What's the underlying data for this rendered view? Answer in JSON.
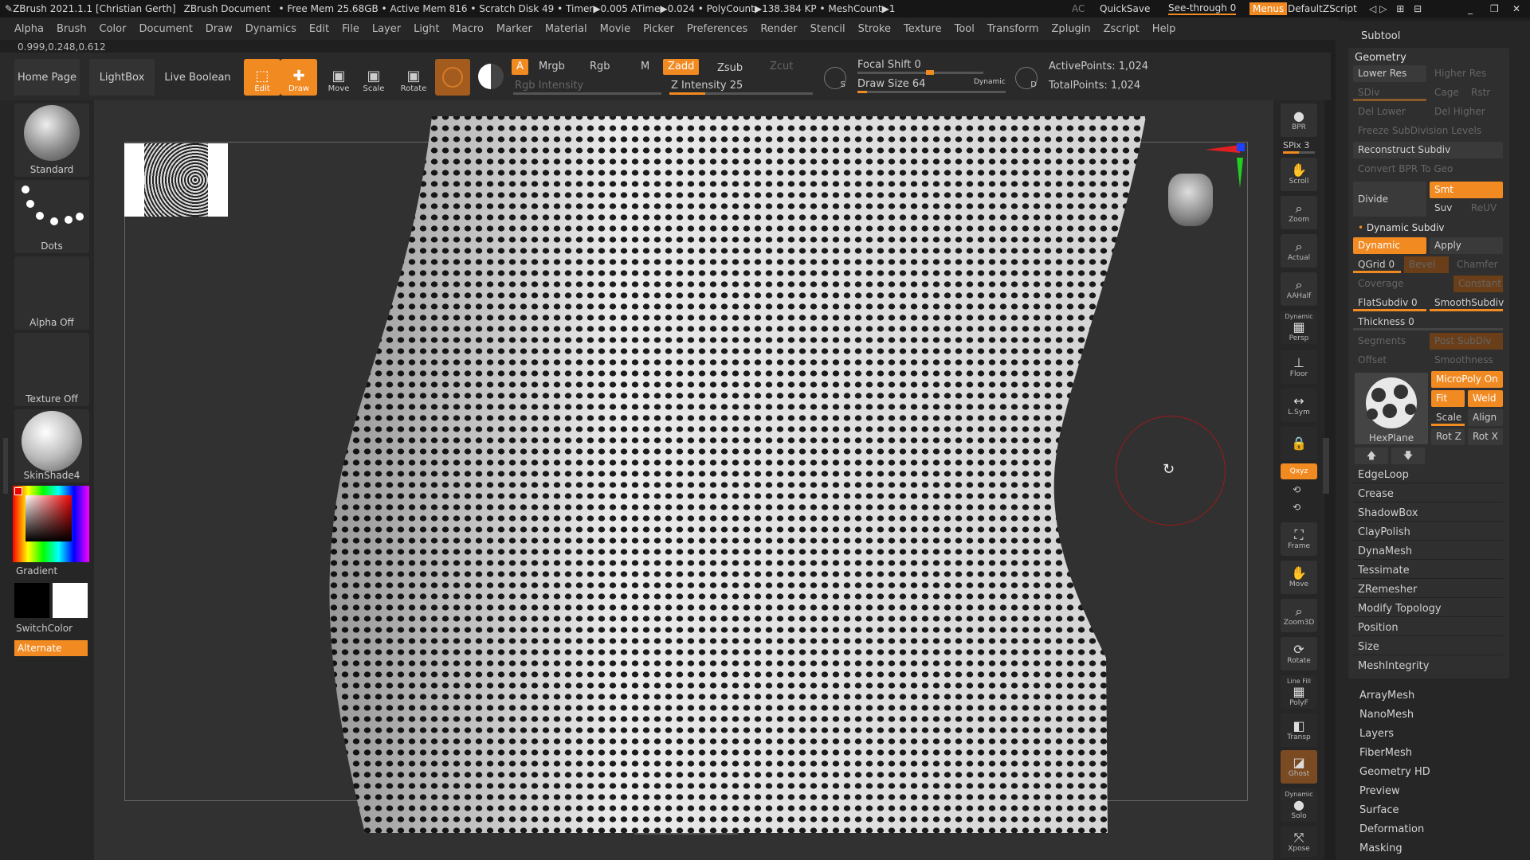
{
  "titlebar": {
    "app": "ZBrush 2021.1.1 [Christian Gerth]",
    "doc": "ZBrush Document",
    "stats": "• Free Mem 25.68GB • Active Mem 816 • Scratch Disk 49 • Timer▶0.005 ATime▶0.024 • PolyCount▶138.384 KP • MeshCount▶1",
    "ac": "AC",
    "quicksave": "QuickSave",
    "seethrough": "See-through 0",
    "menus": "Menus",
    "script": "DefaultZScript"
  },
  "menubar": [
    "Alpha",
    "Brush",
    "Color",
    "Document",
    "Draw",
    "Dynamics",
    "Edit",
    "File",
    "Layer",
    "Light",
    "Macro",
    "Marker",
    "Material",
    "Movie",
    "Picker",
    "Preferences",
    "Render",
    "Stencil",
    "Stroke",
    "Texture",
    "Tool",
    "Transform",
    "Zplugin",
    "Zscript",
    "Help"
  ],
  "coords": "0.999,0.248,0.612",
  "shelf": {
    "home": "Home Page",
    "lightbox": "LightBox",
    "liveboolean": "Live Boolean",
    "edit": "Edit",
    "draw": "Draw",
    "move": "Move",
    "scale": "Scale",
    "rotate": "Rotate",
    "a": "A",
    "mrgb": "Mrgb",
    "rgb": "Rgb",
    "m": "M",
    "rgbintensity": "Rgb Intensity",
    "zadd": "Zadd",
    "zsub": "Zsub",
    "zcut": "Zcut",
    "zintensity": "Z Intensity 25",
    "zintensity_value": 25,
    "focalshift": "Focal Shift 0",
    "drawsize": "Draw Size 64",
    "drawsize_value": 64,
    "dynamic": "Dynamic",
    "s": "S",
    "d": "D",
    "activepoints": "ActivePoints: 1,024",
    "totalpoints": "TotalPoints: 1,024"
  },
  "leftshelf": {
    "standard": "Standard",
    "dots": "Dots",
    "alphaoff": "Alpha Off",
    "textureoff": "Texture Off",
    "skinshade": "SkinShade4",
    "gradient": "Gradient",
    "switchcolor": "SwitchColor",
    "alternate": "Alternate"
  },
  "rightshelf": {
    "bpr": "BPR",
    "spix": "SPix 3",
    "scroll": "Scroll",
    "zoom": "Zoom",
    "actual": "Actual",
    "aahalf": "AAHalf",
    "dynamic": "Dynamic",
    "persp": "Persp",
    "floor": "Floor",
    "lsym": "L.Sym",
    "xyz": "Qxyz",
    "frame": "Frame",
    "move": "Move",
    "zoom3d": "Zoom3D",
    "rotate": "Rotate",
    "linefill": "Line Fill",
    "polyf": "PolyF",
    "transp": "Transp",
    "ghost": "Ghost",
    "solo": "Solo",
    "xpose": "Xpose"
  },
  "subtool": {
    "header": "Subtool",
    "geometry": "Geometry",
    "lowerres": "Lower Res",
    "higherres": "Higher Res",
    "sdiv": "SDiv",
    "cage": "Cage",
    "rstr": "Rstr",
    "dellower": "Del Lower",
    "delhigher": "Del Higher",
    "freeze": "Freeze SubDivision Levels",
    "reconstruct": "Reconstruct Subdiv",
    "convertbpr": "Convert BPR To Geo",
    "divide": "Divide",
    "smt": "Smt",
    "suv": "Suv",
    "reuv": "ReUV",
    "dynsubdiv": "Dynamic Subdiv",
    "dynamic": "Dynamic",
    "apply": "Apply",
    "qgrid": "QGrid 0",
    "bevel": "Bevel",
    "chamfer": "Chamfer",
    "coverage": "Coverage",
    "constant": "Constant",
    "flatsubdiv": "FlatSubdiv 0",
    "smoothsubdiv": "SmoothSubdiv",
    "thickness": "Thickness 0",
    "segments": "Segments",
    "postsubdiv": "Post SubDiv",
    "offset": "Offset",
    "smoothness": "Smoothness",
    "micropoly": "MicroPoly On",
    "fit": "Fit",
    "weld": "Weld",
    "scale": "Scale",
    "align": "Align",
    "rotz": "Rot Z",
    "rotx": "Rot X",
    "hexplane": "HexPlane",
    "edgeloop": "EdgeLoop",
    "crease": "Crease",
    "shadowbox": "ShadowBox",
    "claypolish": "ClayPolish",
    "dynamesh": "DynaMesh",
    "tessimate": "Tessimate",
    "zremesher": "ZRemesher",
    "modifytopology": "Modify Topology",
    "position": "Position",
    "size": "Size",
    "meshintegrity": "MeshIntegrity"
  },
  "trayitems": [
    "ArrayMesh",
    "NanoMesh",
    "Layers",
    "FiberMesh",
    "Geometry HD",
    "Preview",
    "Surface",
    "Deformation",
    "Masking"
  ],
  "colors": {
    "accent": "#f28a22",
    "bg": "#262626",
    "canvas": "#313131"
  }
}
